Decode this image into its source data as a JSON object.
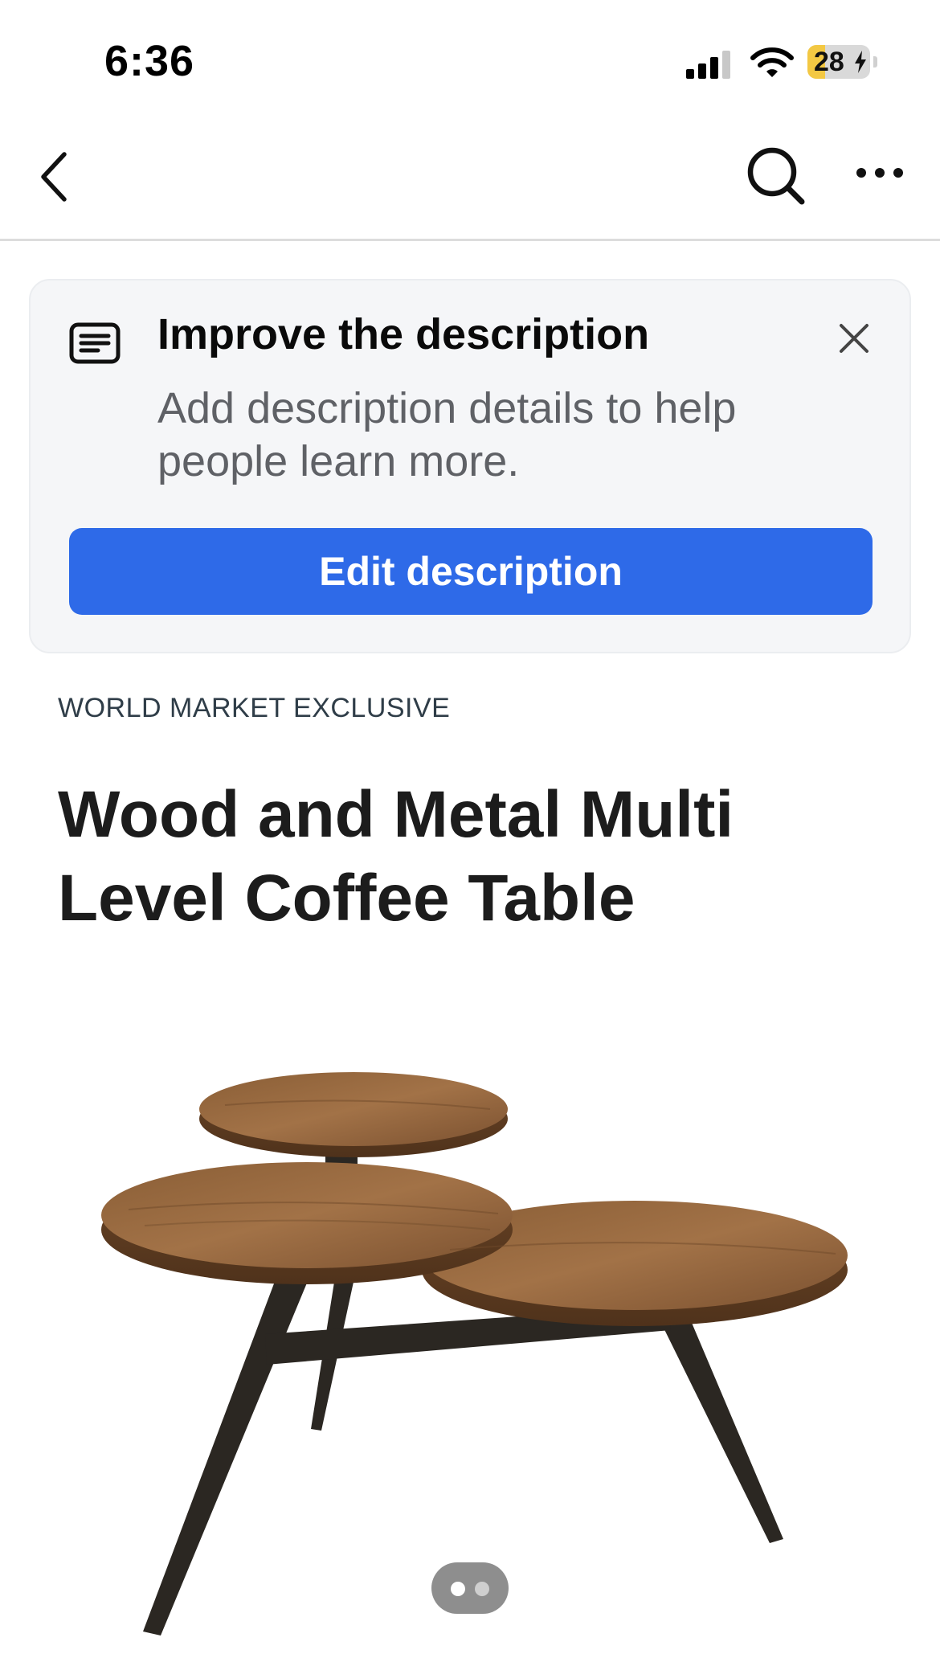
{
  "status_bar": {
    "time": "6:36",
    "battery_level": "28",
    "battery_fraction": 0.28,
    "icons": [
      "cellular-signal-icon",
      "wifi-icon",
      "battery-charging-icon"
    ]
  },
  "nav": {
    "icons": [
      "chevron-left-icon",
      "search-icon",
      "more-horizontal-icon"
    ]
  },
  "prompt_card": {
    "icon": "document-text-icon",
    "title": "Improve the description",
    "text": "Add description details to help people learn more.",
    "button_label": "Edit description",
    "close_icon": "close-icon",
    "button_color": "#2e6ae8"
  },
  "product": {
    "eyebrow": "WORLD MARKET EXCLUSIVE",
    "title": "Wood and Metal Multi Level Coffee Table"
  },
  "carousel": {
    "pages": 2,
    "current_page": 1
  }
}
